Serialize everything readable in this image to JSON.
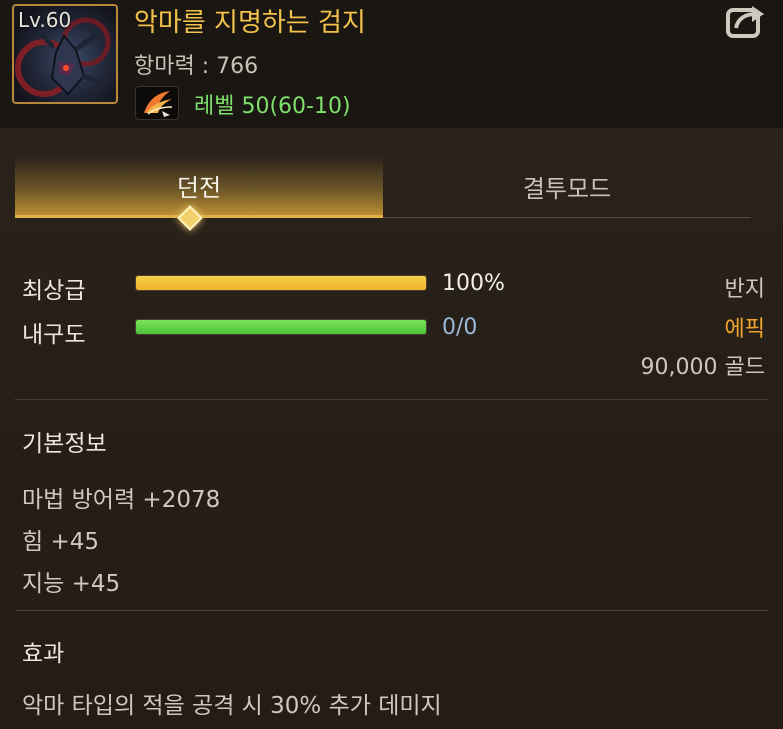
{
  "item": {
    "level_badge": "Lv.60",
    "name": "악마를 지명하는 검지",
    "sub_info": "항마력 : 766",
    "level_text": "레벨 50(60-10)",
    "icon": "demon-ring-icon",
    "level_icon": "wing-icon"
  },
  "tabs": {
    "active": "던전",
    "inactive": "결투모드"
  },
  "stats": {
    "grade": {
      "label": "최상급",
      "value": "100%",
      "fill": 1.0,
      "color": "#f0b428"
    },
    "durability": {
      "label": "내구도",
      "value": "0/0",
      "fill": 1.0,
      "color": "#4cc23a"
    }
  },
  "right_info": {
    "type": "반지",
    "rarity": "에픽",
    "price": "90,000 골드",
    "rarity_color": "#f2a52b"
  },
  "basic_info": {
    "title": "기본정보",
    "lines": [
      "마법 방어력 +2078",
      "힘 +45",
      "지능 +45"
    ]
  },
  "effect": {
    "title": "효과",
    "lines": [
      "악마 타입의 적을 공격 시 30% 추가 데미지"
    ]
  },
  "colors": {
    "title": "#f2c24a",
    "level_green": "#7ee06a",
    "accent_gold": "#e2b247"
  }
}
